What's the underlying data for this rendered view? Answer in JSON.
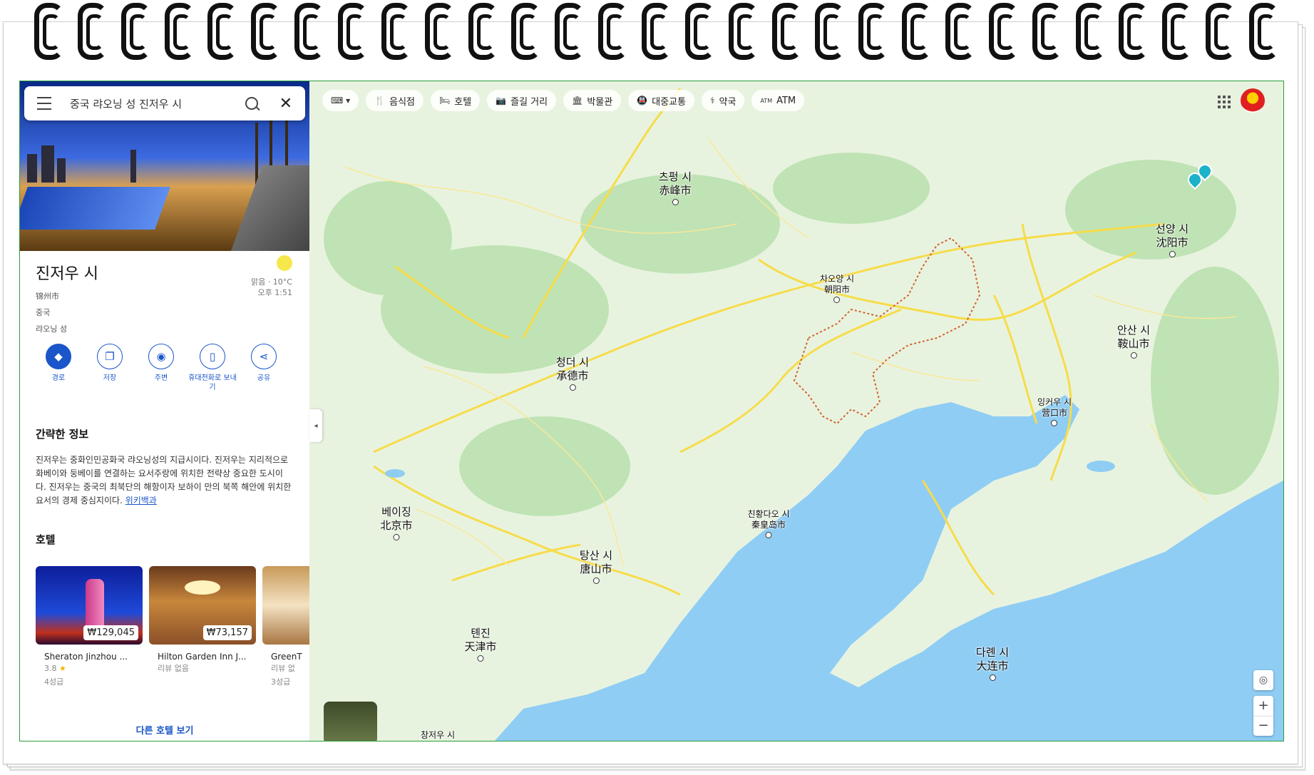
{
  "search": {
    "query": "중국 랴오닝 성 진저우 시"
  },
  "place": {
    "title": "진저우 시",
    "native_name": "锦州市",
    "country": "중국",
    "province": "랴오닝 성",
    "weather_label": "맑음 · 10°C",
    "time_label": "오후 1:51"
  },
  "actions": [
    {
      "label": "경로",
      "icon": "directions-icon"
    },
    {
      "label": "저장",
      "icon": "bookmark-icon"
    },
    {
      "label": "주변",
      "icon": "nearby-icon"
    },
    {
      "label": "휴대전화로 보내기",
      "icon": "send-to-phone-icon"
    },
    {
      "label": "공유",
      "icon": "share-icon"
    }
  ],
  "about": {
    "heading": "간략한 정보",
    "text": "진저우는 중화인민공화국 랴오닝성의 지급시이다. 진저우는 지리적으로 화베이와 둥베이를 연결하는 요서주랑에 위치한 전략상 중요한 도시이다. 진저우는 중국의 최북단의 해항이자 보하이 만의 북쪽 해안에 위치한 요서의 경제 중심지이다.",
    "source_link": "위키백과"
  },
  "hotels": {
    "heading": "호텔",
    "more_label": "다른 호텔 보기",
    "items": [
      {
        "name": "Sheraton Jinzhou ...",
        "price": "₩129,045",
        "rating": "3.8",
        "reviews": "",
        "class": "4성급"
      },
      {
        "name": "Hilton Garden Inn J...",
        "price": "₩73,157",
        "rating": "",
        "reviews": "리뷰 없음",
        "class": ""
      },
      {
        "name": "GreenT",
        "price": "",
        "rating": "",
        "reviews": "리뷰 없",
        "class": "3성급"
      }
    ]
  },
  "map_chips": [
    {
      "label": "",
      "icon": "keyboard-icon"
    },
    {
      "label": "음식점",
      "icon": "restaurant-icon"
    },
    {
      "label": "호텔",
      "icon": "hotel-icon"
    },
    {
      "label": "즐길 거리",
      "icon": "camera-icon"
    },
    {
      "label": "박물관",
      "icon": "museum-icon"
    },
    {
      "label": "대중교통",
      "icon": "transit-icon"
    },
    {
      "label": "약국",
      "icon": "pharmacy-icon"
    },
    {
      "label": "ATM",
      "icon": "atm-icon"
    }
  ],
  "cities": [
    {
      "ko": "츠펑 시",
      "zh": "赤峰市"
    },
    {
      "ko": "차오양 시",
      "zh": "朝阳市"
    },
    {
      "ko": "선양 시",
      "zh": "沈阳市"
    },
    {
      "ko": "안산 시",
      "zh": "鞍山市"
    },
    {
      "ko": "청더 시",
      "zh": "承德市"
    },
    {
      "ko": "잉커우 시",
      "zh": "营口市"
    },
    {
      "ko": "베이징",
      "zh": "北京市"
    },
    {
      "ko": "친황다오 시",
      "zh": "秦皇岛市"
    },
    {
      "ko": "탕산 시",
      "zh": "唐山市"
    },
    {
      "ko": "톈진",
      "zh": "天津市"
    },
    {
      "ko": "다롄 시",
      "zh": "大连市"
    }
  ],
  "bottom": {
    "city_partial": "창저우 시"
  },
  "colors": {
    "accent": "#1a56c9",
    "sea": "#8fcdf4",
    "land": "#e8f3df",
    "road": "#f7dc4a",
    "boundary": "#d2632e",
    "pin": "#1cb2c9"
  }
}
